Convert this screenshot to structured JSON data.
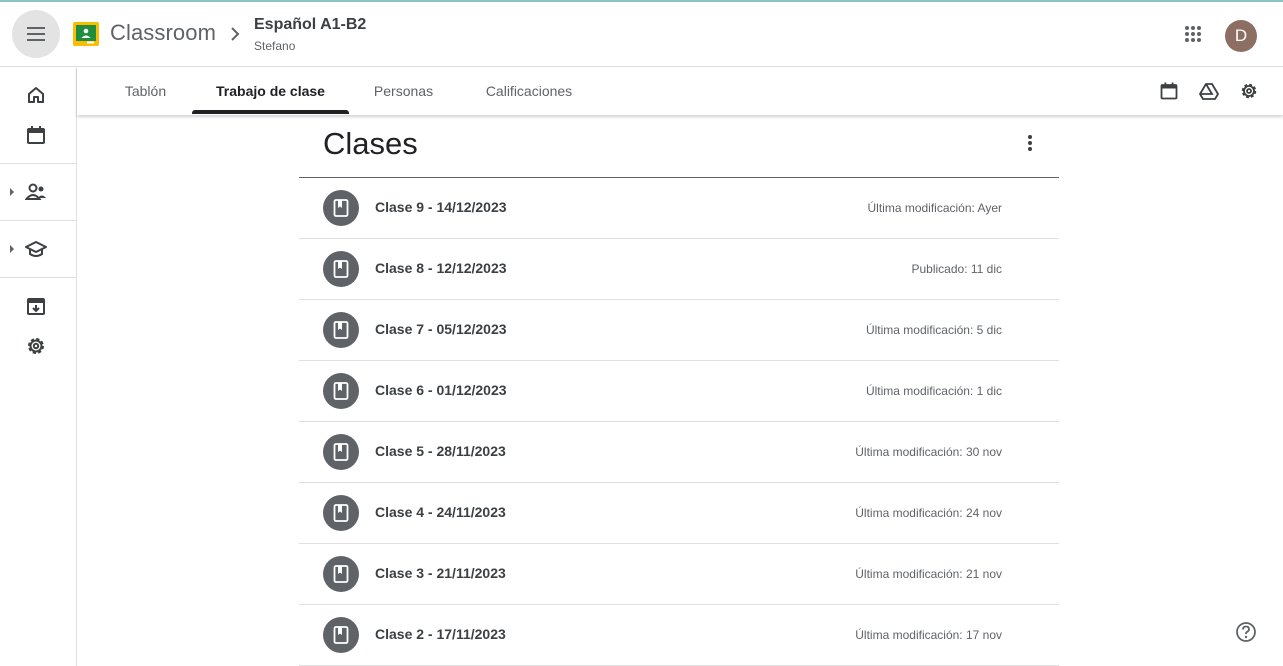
{
  "header": {
    "brand": "Classroom",
    "course_title": "Español A1-B2",
    "course_subtitle": "Stefano",
    "avatar_initial": "D",
    "icons": [
      "menu-icon",
      "classroom-logo",
      "chevron-right-icon",
      "apps-grid-icon"
    ]
  },
  "rail": {
    "icons": [
      "home-icon",
      "calendar-icon",
      "teaching-people-icon",
      "enrolled-school-icon",
      "archive-icon",
      "settings-icon"
    ]
  },
  "tabs": {
    "items": [
      {
        "label": "Tablón"
      },
      {
        "label": "Trabajo de clase"
      },
      {
        "label": "Personas"
      },
      {
        "label": "Calificaciones"
      }
    ],
    "active": "Trabajo de clase",
    "right_icons": [
      "calendar-icon",
      "drive-icon",
      "settings-icon"
    ]
  },
  "section": {
    "title": "Clases"
  },
  "materials": [
    {
      "title": "Clase 9 - 14/12/2023",
      "meta": "Última modificación: Ayer"
    },
    {
      "title": "Clase 8 - 12/12/2023",
      "meta": "Publicado: 11 dic"
    },
    {
      "title": "Clase 7 - 05/12/2023",
      "meta": "Última modificación: 5 dic"
    },
    {
      "title": "Clase 6 - 01/12/2023",
      "meta": "Última modificación: 1 dic"
    },
    {
      "title": "Clase 5 - 28/11/2023",
      "meta": "Última modificación: 30 nov"
    },
    {
      "title": "Clase 4 - 24/11/2023",
      "meta": "Última modificación: 24 nov"
    },
    {
      "title": "Clase 3 - 21/11/2023",
      "meta": "Última modificación: 21 nov"
    },
    {
      "title": "Clase 2 - 17/11/2023",
      "meta": "Última modificación: 17 nov"
    }
  ],
  "colors": {
    "logo_yellow": "#fbbc04",
    "logo_green": "#1e8e3e",
    "avatar": "#8d6e63",
    "icon_circle": "#5f6368"
  }
}
